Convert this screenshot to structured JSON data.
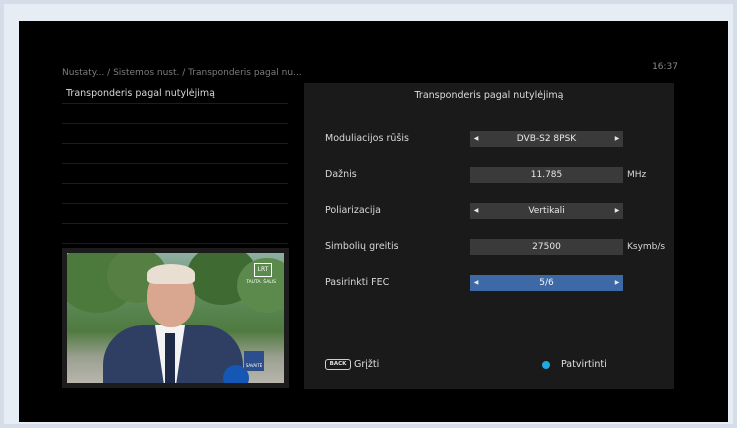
{
  "header": {
    "breadcrumb": "Nustaty... / Sistemos nust.  / Transponderis pagal nu...",
    "clock": "16:37"
  },
  "left_list": {
    "items": [
      "Transponderis pagal nutylėjimą",
      "",
      "",
      "",
      "",
      "",
      "",
      ""
    ]
  },
  "preview": {
    "channel_logo": "LRT",
    "channel_sub": "TAUTA. ŠALIS",
    "show_badge": "SAVAITĖ"
  },
  "panel": {
    "title": "Transponderis pagal nutylėjimą",
    "rows": [
      {
        "label": "Moduliacijos rūšis",
        "value": "DVB-S2 8PSK",
        "unit": "",
        "type": "select"
      },
      {
        "label": "Dažnis",
        "value": "11.785",
        "unit": "MHz",
        "type": "input"
      },
      {
        "label": "Poliarizacija",
        "value": "Vertikali",
        "unit": "",
        "type": "select"
      },
      {
        "label": "Simbolių greitis",
        "value": "27500",
        "unit": "Ksymb/s",
        "type": "input"
      },
      {
        "label": "Pasirinkti FEC",
        "value": "5/6",
        "unit": "",
        "type": "select",
        "selected": true
      }
    ]
  },
  "footer": {
    "back_key": "BACK",
    "back_label": "Grįžti",
    "confirm_label": "Patvirtinti",
    "confirm_color": "#21a7e2"
  },
  "colors": {
    "selected_field": "#3d6aa6",
    "field": "#3a3a3a",
    "panel": "#1a1a1a"
  }
}
